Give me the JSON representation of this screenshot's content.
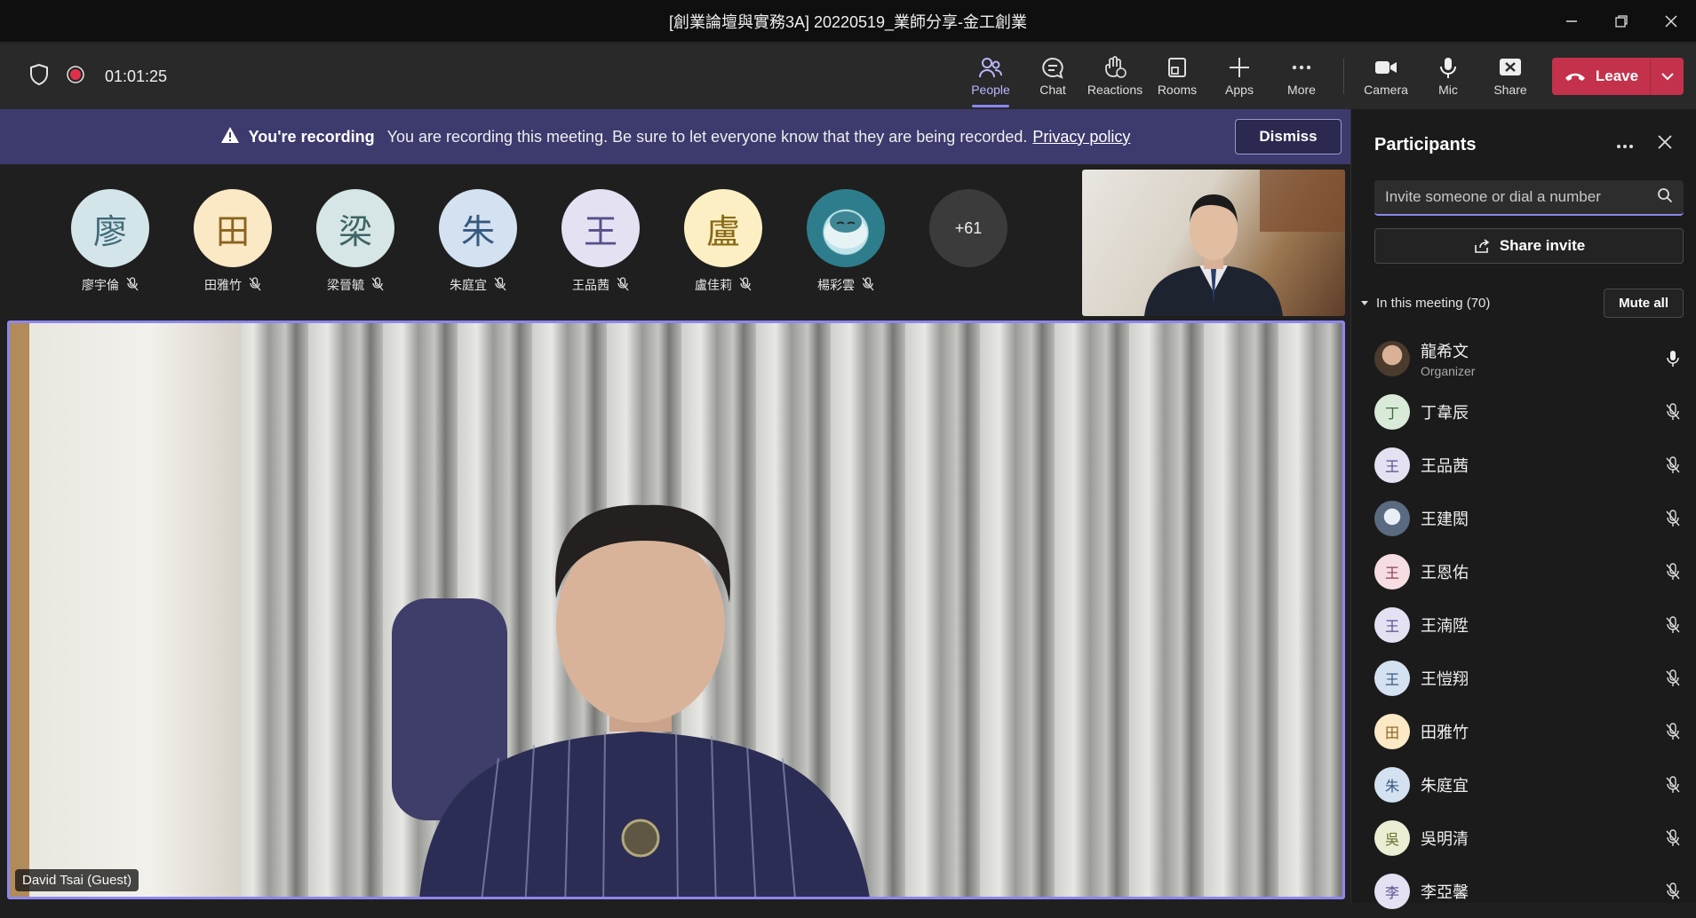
{
  "window": {
    "title": "[創業論壇與實務3A] 20220519_業師分享-金工創業"
  },
  "toolbar": {
    "timer": "01:01:25",
    "tools": [
      {
        "label": "People",
        "icon": "people-icon",
        "active": true
      },
      {
        "label": "Chat",
        "icon": "chat-icon",
        "active": false
      },
      {
        "label": "Reactions",
        "icon": "reactions-icon",
        "active": false
      },
      {
        "label": "Rooms",
        "icon": "rooms-icon",
        "active": false
      },
      {
        "label": "Apps",
        "icon": "plus-icon",
        "active": false
      },
      {
        "label": "More",
        "icon": "more-icon",
        "active": false
      }
    ],
    "media": [
      {
        "label": "Camera",
        "icon": "camera-icon"
      },
      {
        "label": "Mic",
        "icon": "mic-icon"
      },
      {
        "label": "Share",
        "icon": "share-tray-icon"
      }
    ],
    "leave_label": "Leave",
    "leave_color": "#c4314b"
  },
  "banner": {
    "title": "You're recording",
    "message": "You are recording this meeting. Be sure to let everyone know that they are being recorded.",
    "link": "Privacy policy",
    "dismiss": "Dismiss",
    "color": "#3d3a6e"
  },
  "gallery": {
    "attendees": [
      {
        "initial": "廖",
        "name": "廖宇倫",
        "bg": "#d4e5ea",
        "fg": "#3f6a78"
      },
      {
        "initial": "田",
        "name": "田雅竹",
        "bg": "#fbe8c5",
        "fg": "#8a6420"
      },
      {
        "initial": "梁",
        "name": "梁晉毓",
        "bg": "#d6e5e5",
        "fg": "#3d6565"
      },
      {
        "initial": "朱",
        "name": "朱庭宜",
        "bg": "#d4e1f0",
        "fg": "#36597f"
      },
      {
        "initial": "王",
        "name": "王品茜",
        "bg": "#e4e1f2",
        "fg": "#56508a"
      },
      {
        "initial": "盧",
        "name": "盧佳莉",
        "bg": "#fcefc4",
        "fg": "#8a6a14"
      },
      {
        "initial": "",
        "name": "楊彩雲",
        "bg": "#2e7d8c",
        "fg": "#ffffff",
        "photo": true
      }
    ],
    "overflow": "+61"
  },
  "main_video": {
    "name_tag": "David Tsai (Guest)",
    "highlight_color": "#8c87ee"
  },
  "panel": {
    "title": "Participants",
    "search_placeholder": "Invite someone or dial a number",
    "share_invite": "Share invite",
    "section_label": "In this meeting (70)",
    "mute_all": "Mute all",
    "participants": [
      {
        "initial": "",
        "name": "龍希文",
        "role": "Organizer",
        "photo": true,
        "bg": "#6b5a48",
        "fg": "#fff",
        "muted": false
      },
      {
        "initial": "丁",
        "name": "丁韋辰",
        "role": "",
        "bg": "#d9ead9",
        "fg": "#3f6b3f",
        "muted": true
      },
      {
        "initial": "王",
        "name": "王品茜",
        "role": "",
        "bg": "#e4e1f2",
        "fg": "#56508a",
        "muted": true
      },
      {
        "initial": "",
        "name": "王建閎",
        "role": "",
        "photo": true,
        "bg": "#9aa7b8",
        "fg": "#fff",
        "muted": true
      },
      {
        "initial": "王",
        "name": "王恩佑",
        "role": "",
        "bg": "#f6dde2",
        "fg": "#8a3f50",
        "muted": true
      },
      {
        "initial": "王",
        "name": "王湳陞",
        "role": "",
        "bg": "#e4e1f2",
        "fg": "#56508a",
        "muted": true
      },
      {
        "initial": "王",
        "name": "王愷翔",
        "role": "",
        "bg": "#d4e1f0",
        "fg": "#36597f",
        "muted": true
      },
      {
        "initial": "田",
        "name": "田雅竹",
        "role": "",
        "bg": "#fbe8c5",
        "fg": "#8a6420",
        "muted": true
      },
      {
        "initial": "朱",
        "name": "朱庭宜",
        "role": "",
        "bg": "#d4e1f0",
        "fg": "#36597f",
        "muted": true
      },
      {
        "initial": "吳",
        "name": "吳明清",
        "role": "",
        "bg": "#eceed4",
        "fg": "#6b6b2a",
        "muted": true
      },
      {
        "initial": "李",
        "name": "李亞馨",
        "role": "",
        "bg": "#e4e1f2",
        "fg": "#56508a",
        "muted": true
      }
    ]
  }
}
